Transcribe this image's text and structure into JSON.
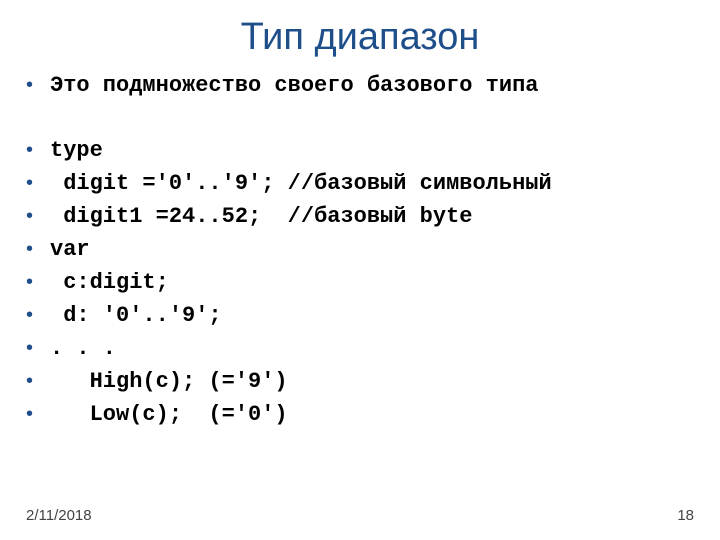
{
  "title": "Тип диапазон",
  "intro": "Это подмножество своего базового типа",
  "lines": [
    "type",
    " digit ='0'..'9'; //базовый символьный",
    " digit1 =24..52;  //базовый byte",
    "var",
    " c:digit;",
    " d: '0'..'9';",
    ". . .",
    "   High(c); (='9')",
    "   Low(c);  (='0')"
  ],
  "footer": {
    "date": "2/11/2018",
    "page": "18"
  },
  "bullet_char": "•"
}
